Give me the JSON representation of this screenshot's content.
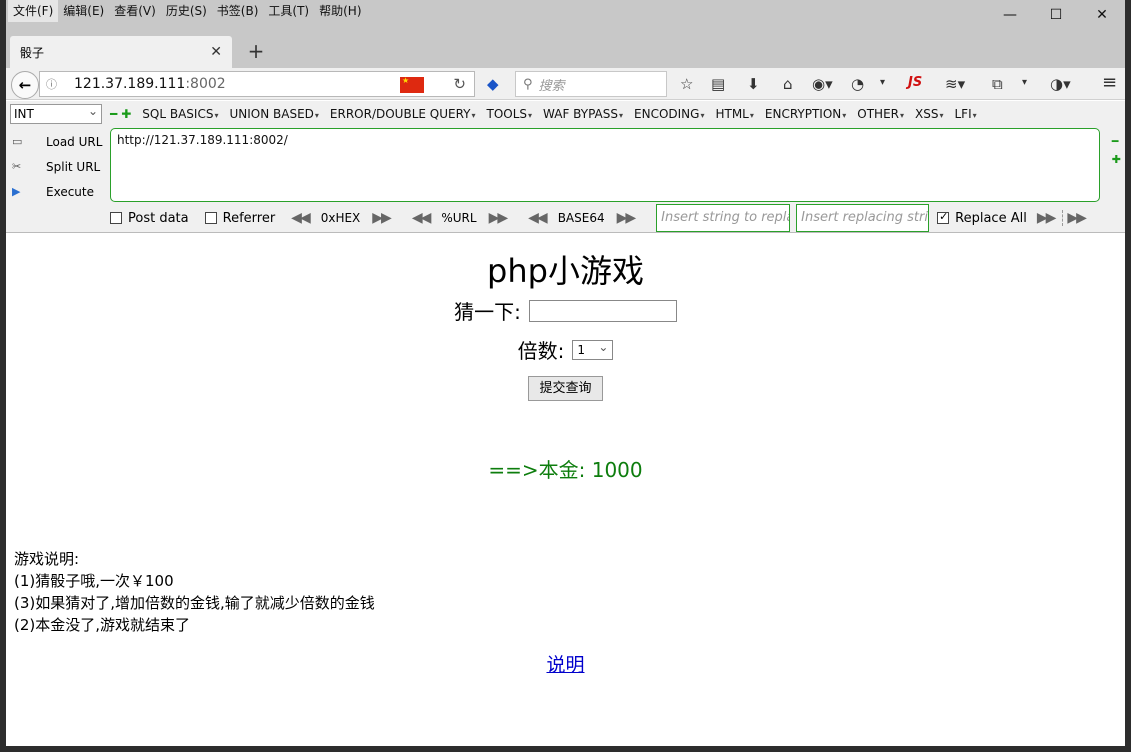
{
  "browser": {
    "menu": [
      "文件(F)",
      "编辑(E)",
      "查看(V)",
      "历史(S)",
      "书签(B)",
      "工具(T)",
      "帮助(H)"
    ],
    "tab_title": "骰子",
    "url_host": "121.37.189.111",
    "url_port": ":8002",
    "search_placeholder": "搜索",
    "js_label": "JS"
  },
  "hackbar": {
    "select_value": "INT",
    "menus": [
      "SQL BASICS",
      "UNION BASED",
      "ERROR/DOUBLE QUERY",
      "TOOLS",
      "WAF BYPASS",
      "ENCODING",
      "HTML",
      "ENCRYPTION",
      "OTHER",
      "XSS",
      "LFI"
    ],
    "actions": [
      "Load URL",
      "Split URL",
      "Execute"
    ],
    "url_value": "http://121.37.189.111:8002/",
    "post_data_label": "Post data",
    "referrer_label": "Referrer",
    "hex_label": "0xHEX",
    "url_enc_label": "%URL",
    "base64_label": "BASE64",
    "replace_placeholder": "Insert string to replace",
    "replacing_placeholder": "Insert replacing string",
    "replace_all_label": "Replace All"
  },
  "page": {
    "title": "php小游戏",
    "guess_label": "猜一下:",
    "multiplier_label": "倍数:",
    "multiplier_value": "1",
    "submit_label": "提交查询",
    "balance": "==>本金: 1000",
    "rules_title": "游戏说明:",
    "rules": [
      "(1)猜骰子哦,一次￥100",
      "(3)如果猜对了,增加倍数的金钱,输了就减少倍数的金钱",
      "(2)本金没了,游戏就结束了"
    ],
    "help_link": "说明"
  },
  "colors": {
    "balance": "#0d7d0d",
    "link": "#0000cc",
    "hackbar_border": "#2aa02a"
  }
}
